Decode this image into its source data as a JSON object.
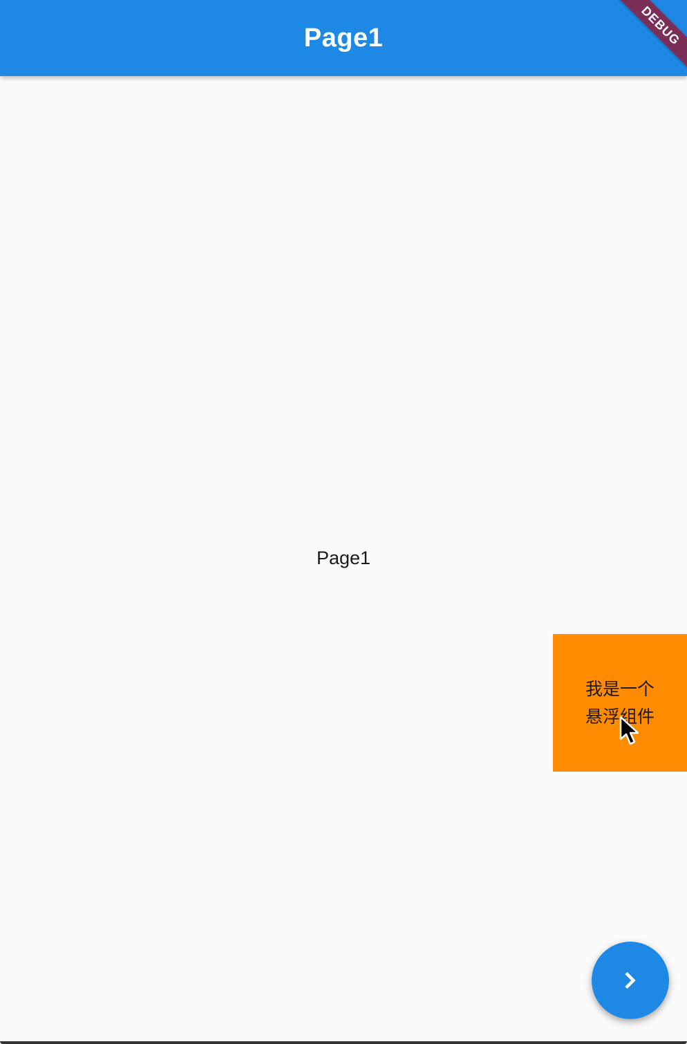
{
  "app_bar": {
    "title": "Page1",
    "color": "#1e88e5"
  },
  "debug_banner": {
    "label": "DEBUG",
    "color": "#8b1e3f"
  },
  "body": {
    "center_text": "Page1"
  },
  "floating_widget": {
    "text": "我是一个悬浮组件",
    "color": "#ff8c00"
  },
  "fab": {
    "icon": "chevron-right-icon",
    "color": "#1e88e5"
  },
  "cursor": {
    "icon": "mouse-pointer-icon"
  }
}
